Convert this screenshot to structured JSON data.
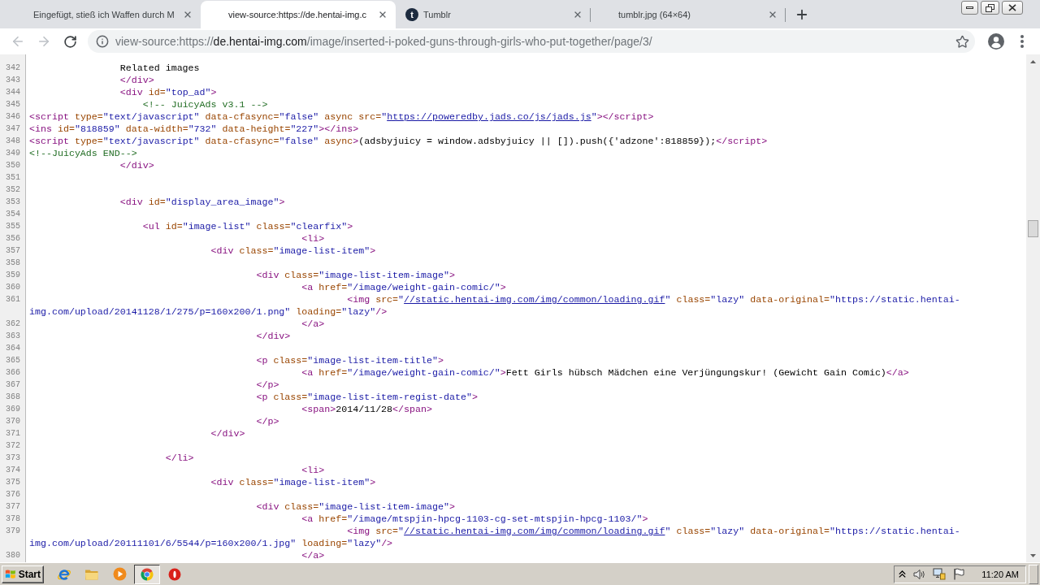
{
  "tabs": [
    {
      "title": "Eingefügt, stieß ich Waffen durch M",
      "selected": false
    },
    {
      "title": "view-source:https://de.hentai-img.c",
      "selected": true
    },
    {
      "title": "Tumblr",
      "favicon": "t",
      "selected": false
    },
    {
      "title": "tumblr.jpg (64×64)",
      "selected": false
    }
  ],
  "toolbar": {
    "back": {
      "disabled": true
    },
    "forward": {
      "disabled": true
    },
    "address": {
      "scheme": "view-source:https://",
      "host": "de.hentai-img.com",
      "path": "/image/inserted-i-poked-guns-through-girls-who-put-together/page/3/"
    }
  },
  "source": {
    "lines": [
      {
        "number": "342",
        "tokens": [
          {
            "kind": "text",
            "text": "\t\tRelated images"
          }
        ]
      },
      {
        "number": "343",
        "tokens": [
          {
            "kind": "tag",
            "text": "\t\t</div>"
          }
        ]
      },
      {
        "number": "344",
        "tokens": [
          {
            "kind": "tag",
            "text": "\t\t<div"
          },
          {
            "kind": "attr",
            "text": " id="
          },
          {
            "kind": "value",
            "text": "\"top_ad\""
          },
          {
            "kind": "tag",
            "text": ">"
          }
        ]
      },
      {
        "number": "345",
        "tokens": [
          {
            "kind": "comment",
            "text": "\t\t    <!-- JuicyAds v3.1 -->"
          }
        ]
      },
      {
        "number": "346",
        "tokens": [
          {
            "kind": "tag",
            "text": "<script"
          },
          {
            "kind": "attr",
            "text": " type="
          },
          {
            "kind": "value",
            "text": "\"text/javascript\""
          },
          {
            "kind": "attr",
            "text": " data-cfasync="
          },
          {
            "kind": "value",
            "text": "\"false\""
          },
          {
            "kind": "attr",
            "text": " async src="
          },
          {
            "kind": "value",
            "text": "\""
          },
          {
            "kind": "link",
            "text": "https://poweredby.jads.co/js/jads.js"
          },
          {
            "kind": "value",
            "text": "\""
          },
          {
            "kind": "tag",
            "text": "></script>"
          }
        ]
      },
      {
        "number": "347",
        "tokens": [
          {
            "kind": "tag",
            "text": "<ins"
          },
          {
            "kind": "attr",
            "text": " id="
          },
          {
            "kind": "value",
            "text": "\"818859\""
          },
          {
            "kind": "attr",
            "text": " data-width="
          },
          {
            "kind": "value",
            "text": "\"732\""
          },
          {
            "kind": "attr",
            "text": " data-height="
          },
          {
            "kind": "value",
            "text": "\"227\""
          },
          {
            "kind": "tag",
            "text": "></ins>"
          }
        ]
      },
      {
        "number": "348",
        "tokens": [
          {
            "kind": "tag",
            "text": "<script"
          },
          {
            "kind": "attr",
            "text": " type="
          },
          {
            "kind": "value",
            "text": "\"text/javascript\""
          },
          {
            "kind": "attr",
            "text": " data-cfasync="
          },
          {
            "kind": "value",
            "text": "\"false\""
          },
          {
            "kind": "attr",
            "text": " async"
          },
          {
            "kind": "tag",
            "text": ">"
          },
          {
            "kind": "text",
            "text": "(adsbyjuicy = window.adsbyjuicy || []).push({'adzone':818859});"
          },
          {
            "kind": "tag",
            "text": "</script>"
          }
        ]
      },
      {
        "number": "349",
        "tokens": [
          {
            "kind": "comment",
            "text": "<!--JuicyAds END-->"
          }
        ]
      },
      {
        "number": "350",
        "tokens": [
          {
            "kind": "tag",
            "text": "\t\t</div>"
          }
        ]
      },
      {
        "number": "351"
      },
      {
        "number": "352"
      },
      {
        "number": "353",
        "tokens": [
          {
            "kind": "tag",
            "text": "\t\t<div"
          },
          {
            "kind": "attr",
            "text": " id="
          },
          {
            "kind": "value",
            "text": "\"display_area_image\""
          },
          {
            "kind": "tag",
            "text": ">"
          }
        ]
      },
      {
        "number": "354"
      },
      {
        "number": "355",
        "tokens": [
          {
            "kind": "tag",
            "text": "\t\t    <ul"
          },
          {
            "kind": "attr",
            "text": " id="
          },
          {
            "kind": "value",
            "text": "\"image-list\""
          },
          {
            "kind": "attr",
            "text": " class="
          },
          {
            "kind": "value",
            "text": "\"clearfix\""
          },
          {
            "kind": "tag",
            "text": ">"
          }
        ]
      },
      {
        "number": "356",
        "tokens": [
          {
            "kind": "tag",
            "text": "\t\t\t\t\t\t<li>"
          }
        ]
      },
      {
        "number": "357",
        "tokens": [
          {
            "kind": "tag",
            "text": "\t\t\t\t<div"
          },
          {
            "kind": "attr",
            "text": " class="
          },
          {
            "kind": "value",
            "text": "\"image-list-item\""
          },
          {
            "kind": "tag",
            "text": ">"
          }
        ]
      },
      {
        "number": "358"
      },
      {
        "number": "359",
        "tokens": [
          {
            "kind": "tag",
            "text": "\t\t\t\t\t<div"
          },
          {
            "kind": "attr",
            "text": " class="
          },
          {
            "kind": "value",
            "text": "\"image-list-item-image\""
          },
          {
            "kind": "tag",
            "text": ">"
          }
        ]
      },
      {
        "number": "360",
        "tokens": [
          {
            "kind": "tag",
            "text": "\t\t\t\t\t\t<a"
          },
          {
            "kind": "attr",
            "text": " href="
          },
          {
            "kind": "value",
            "text": "\"/image/weight-gain-comic/\""
          },
          {
            "kind": "tag",
            "text": ">"
          }
        ]
      },
      {
        "number": "361",
        "tokens": [
          {
            "kind": "tag",
            "text": "\t\t\t\t\t\t\t<img"
          },
          {
            "kind": "attr",
            "text": " src="
          },
          {
            "kind": "value",
            "text": "\""
          },
          {
            "kind": "link",
            "text": "//static.hentai-img.com/img/common/loading.gif"
          },
          {
            "kind": "value",
            "text": "\""
          },
          {
            "kind": "attr",
            "text": " class="
          },
          {
            "kind": "value",
            "text": "\"lazy\""
          },
          {
            "kind": "attr",
            "text": " data-original="
          },
          {
            "kind": "value",
            "text": "\"https://static.hentai-img.com/upload/20141128/1/275/p=160x200/1.png\""
          },
          {
            "kind": "attr",
            "text": " loading="
          },
          {
            "kind": "value",
            "text": "\"lazy\""
          },
          {
            "kind": "tag",
            "text": "/>"
          }
        ]
      },
      {
        "number": "362",
        "tokens": [
          {
            "kind": "tag",
            "text": "\t\t\t\t\t\t</a>"
          }
        ]
      },
      {
        "number": "363",
        "tokens": [
          {
            "kind": "tag",
            "text": "\t\t\t\t\t</div>"
          }
        ]
      },
      {
        "number": "364"
      },
      {
        "number": "365",
        "tokens": [
          {
            "kind": "tag",
            "text": "\t\t\t\t\t<p"
          },
          {
            "kind": "attr",
            "text": " class="
          },
          {
            "kind": "value",
            "text": "\"image-list-item-title\""
          },
          {
            "kind": "tag",
            "text": ">"
          }
        ]
      },
      {
        "number": "366",
        "tokens": [
          {
            "kind": "tag",
            "text": "\t\t\t\t\t\t<a"
          },
          {
            "kind": "attr",
            "text": " href="
          },
          {
            "kind": "value",
            "text": "\"/image/weight-gain-comic/\""
          },
          {
            "kind": "tag",
            "text": ">"
          },
          {
            "kind": "text",
            "text": "Fett Girls hübsch Mädchen eine Verjüngungskur! (Gewicht Gain Comic)"
          },
          {
            "kind": "tag",
            "text": "</a>"
          }
        ]
      },
      {
        "number": "367",
        "tokens": [
          {
            "kind": "tag",
            "text": "\t\t\t\t\t</p>"
          }
        ]
      },
      {
        "number": "368",
        "tokens": [
          {
            "kind": "tag",
            "text": "\t\t\t\t\t<p"
          },
          {
            "kind": "attr",
            "text": " class="
          },
          {
            "kind": "value",
            "text": "\"image-list-item-regist-date\""
          },
          {
            "kind": "tag",
            "text": ">"
          }
        ]
      },
      {
        "number": "369",
        "tokens": [
          {
            "kind": "tag",
            "text": "\t\t\t\t\t\t<span>"
          },
          {
            "kind": "text",
            "text": "2014/11/28"
          },
          {
            "kind": "tag",
            "text": "</span>"
          }
        ]
      },
      {
        "number": "370",
        "tokens": [
          {
            "kind": "tag",
            "text": "\t\t\t\t\t</p>"
          }
        ]
      },
      {
        "number": "371",
        "tokens": [
          {
            "kind": "tag",
            "text": "\t\t\t\t</div>"
          }
        ]
      },
      {
        "number": "372"
      },
      {
        "number": "373",
        "tokens": [
          {
            "kind": "tag",
            "text": "\t\t\t</li>"
          }
        ]
      },
      {
        "number": "374",
        "tokens": [
          {
            "kind": "tag",
            "text": "\t\t\t\t\t\t<li>"
          }
        ]
      },
      {
        "number": "375",
        "tokens": [
          {
            "kind": "tag",
            "text": "\t\t\t\t<div"
          },
          {
            "kind": "attr",
            "text": " class="
          },
          {
            "kind": "value",
            "text": "\"image-list-item\""
          },
          {
            "kind": "tag",
            "text": ">"
          }
        ]
      },
      {
        "number": "376"
      },
      {
        "number": "377",
        "tokens": [
          {
            "kind": "tag",
            "text": "\t\t\t\t\t<div"
          },
          {
            "kind": "attr",
            "text": " class="
          },
          {
            "kind": "value",
            "text": "\"image-list-item-image\""
          },
          {
            "kind": "tag",
            "text": ">"
          }
        ]
      },
      {
        "number": "378",
        "tokens": [
          {
            "kind": "tag",
            "text": "\t\t\t\t\t\t<a"
          },
          {
            "kind": "attr",
            "text": " href="
          },
          {
            "kind": "value",
            "text": "\"/image/mtspjin-hpcg-1103-cg-set-mtspjin-hpcg-1103/\""
          },
          {
            "kind": "tag",
            "text": ">"
          }
        ]
      },
      {
        "number": "379",
        "tokens": [
          {
            "kind": "tag",
            "text": "\t\t\t\t\t\t\t<img"
          },
          {
            "kind": "attr",
            "text": " src="
          },
          {
            "kind": "value",
            "text": "\""
          },
          {
            "kind": "link",
            "text": "//static.hentai-img.com/img/common/loading.gif"
          },
          {
            "kind": "value",
            "text": "\""
          },
          {
            "kind": "attr",
            "text": " class="
          },
          {
            "kind": "value",
            "text": "\"lazy\""
          },
          {
            "kind": "attr",
            "text": " data-original="
          },
          {
            "kind": "value",
            "text": "\"https://static.hentai-img.com/upload/20111101/6/5544/p=160x200/1.jpg\""
          },
          {
            "kind": "attr",
            "text": " loading="
          },
          {
            "kind": "value",
            "text": "\"lazy\""
          },
          {
            "kind": "tag",
            "text": "/>"
          }
        ]
      },
      {
        "number": "380",
        "tokens": [
          {
            "kind": "tag",
            "text": "\t\t\t\t\t\t</a>"
          }
        ]
      }
    ]
  },
  "taskbar": {
    "start": "Start",
    "apps": [
      {
        "active": false
      },
      {
        "active": false
      },
      {
        "active": false
      },
      {
        "active": true
      },
      {
        "active": false
      }
    ],
    "clock": "11:20 AM"
  }
}
